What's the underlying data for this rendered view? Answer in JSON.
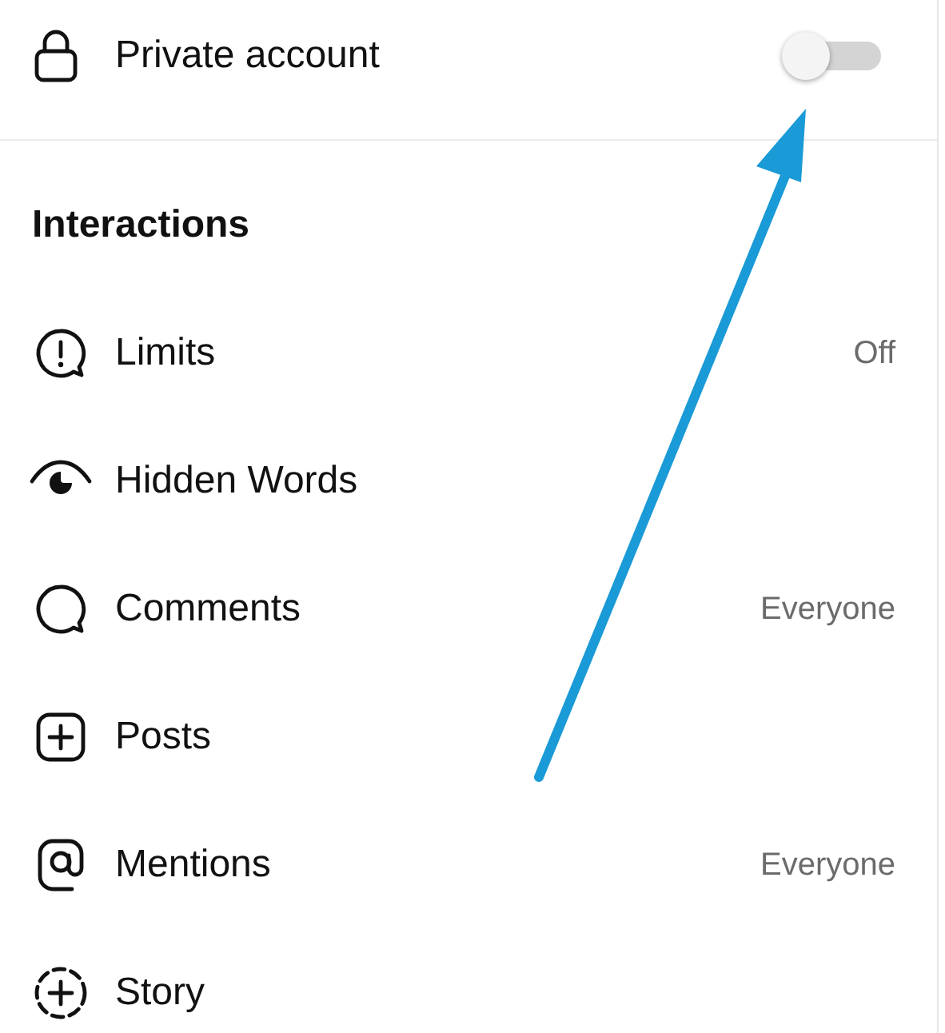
{
  "private_account": {
    "label": "Private account",
    "on": false
  },
  "section": {
    "title": "Interactions"
  },
  "items": [
    {
      "label": "Limits",
      "value": "Off"
    },
    {
      "label": "Hidden Words"
    },
    {
      "label": "Comments",
      "value": "Everyone"
    },
    {
      "label": "Posts"
    },
    {
      "label": "Mentions",
      "value": "Everyone"
    },
    {
      "label": "Story"
    }
  ]
}
